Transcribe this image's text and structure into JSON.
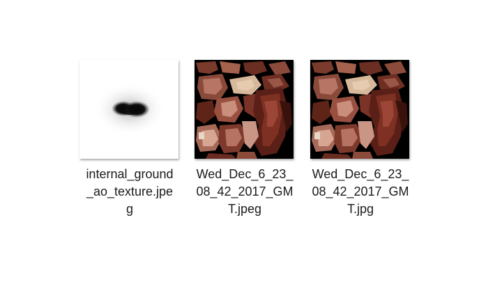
{
  "files": [
    {
      "name_lines": [
        "internal_ground",
        "_ao_texture.jpe",
        "g"
      ],
      "thumbnail": "ambient-occlusion-shadow"
    },
    {
      "name_lines": [
        "Wed_Dec_6_23_",
        "08_42_2017_GM",
        "T.jpeg"
      ],
      "thumbnail": "shoe-texture-atlas"
    },
    {
      "name_lines": [
        "Wed_Dec_6_23_",
        "08_42_2017_GM",
        "T.jpg"
      ],
      "thumbnail": "shoe-texture-atlas"
    }
  ],
  "colors": {
    "background": "#ffffff",
    "text": "#1a1a1a",
    "atlas_background": "#000000",
    "leather_dark": "#5e2418",
    "leather_mid": "#8a4a3a",
    "leather_light": "#c98f7c",
    "tan": "#d8b89a"
  }
}
